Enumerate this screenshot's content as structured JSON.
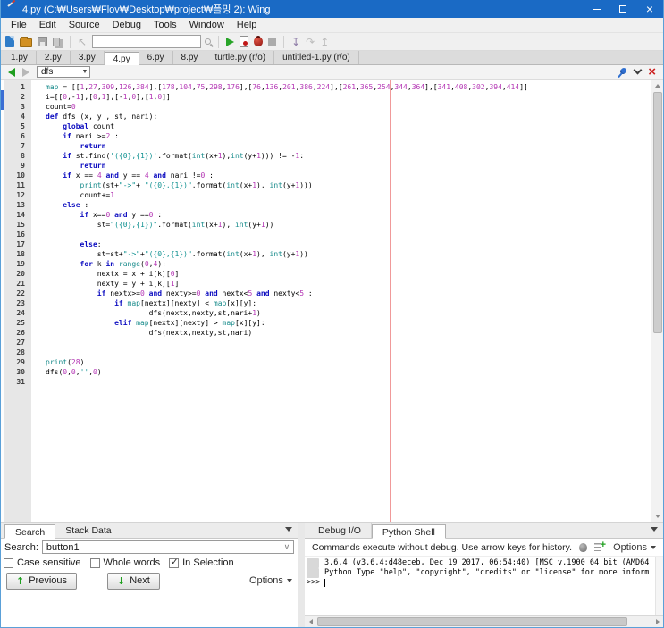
{
  "window": {
    "title": "4.py (C:₩Users₩Flov₩Desktop₩project₩플밍 2): Wing"
  },
  "menu": {
    "items": [
      "File",
      "Edit",
      "Source",
      "Debug",
      "Tools",
      "Window",
      "Help"
    ]
  },
  "toolbar": {
    "search_value": ""
  },
  "file_tabs": {
    "tabs": [
      {
        "label": "1.py",
        "active": false
      },
      {
        "label": "2.py",
        "active": false
      },
      {
        "label": "3.py",
        "active": false
      },
      {
        "label": "4.py",
        "active": true
      },
      {
        "label": "6.py",
        "active": false
      },
      {
        "label": "8.py",
        "active": false
      },
      {
        "label": "turtle.py (r/o)",
        "active": false
      },
      {
        "label": "untitled-1.py (r/o)",
        "active": false
      }
    ]
  },
  "nav": {
    "symbol_selector": "dfs"
  },
  "editor": {
    "syntax_colors": {
      "keyword": "#0d0dc0",
      "builtin": "#188b8b",
      "string": "#0f9191",
      "number": "#b435b4",
      "edge_line": "#f09999"
    },
    "code_lines": [
      "map = [[1,27,309,126,384],[178,104,75,298,176],[76,136,201,386,224],[261,365,254,344,364],[341,408,302,394,414]]",
      "i=[[0,-1],[0,1],[-1,0],[1,0]]",
      "count=0",
      "def dfs (x, y , st, nari):",
      "    global count",
      "    if nari >=2 :",
      "        return",
      "    if st.find('({0},{1})'.format(int(x+1),int(y+1))) != -1:",
      "        return",
      "    if x == 4 and y == 4 and nari !=0 :",
      "        print(st+\"->\"+ \"({0},{1})\".format(int(x+1), int(y+1)))",
      "        count+=1",
      "    else :",
      "        if x==0 and y ==0 :",
      "            st=\"({0},{1})\".format(int(x+1), int(y+1))",
      "",
      "        else:",
      "            st=st+\"->\"+\"({0},{1})\".format(int(x+1), int(y+1))",
      "        for k in range(0,4):",
      "            nextx = x + i[k][0]",
      "            nexty = y + i[k][1]",
      "            if nextx>=0 and nexty>=0 and nextx<5 and nexty<5 :",
      "                if map[nextx][nexty] < map[x][y]:",
      "                        dfs(nextx,nexty,st,nari+1)",
      "                elif map[nextx][nexty] > map[x][y]:",
      "                        dfs(nextx,nexty,st,nari)",
      "",
      "",
      "print(28)",
      "dfs(0,0,'',0)",
      ""
    ]
  },
  "search_panel": {
    "tabs": [
      {
        "label": "Search",
        "active": true
      },
      {
        "label": "Stack Data",
        "active": false
      }
    ],
    "search_label": "Search:",
    "search_value": "button1",
    "checkboxes": [
      {
        "label": "Case sensitive",
        "checked": false
      },
      {
        "label": "Whole words",
        "checked": false
      },
      {
        "label": "In Selection",
        "checked": true
      }
    ],
    "previous_button": "Previous",
    "next_button": "Next",
    "options_label": "Options"
  },
  "shell_panel": {
    "tabs": [
      {
        "label": "Debug I/O",
        "active": false
      },
      {
        "label": "Python Shell",
        "active": true
      }
    ],
    "info_text": "Commands execute without debug.  Use arrow keys for history.",
    "options_label": "Options",
    "output_lines": [
      "3.6.4 (v3.6.4:d48eceb, Dec 19 2017, 06:54:40) [MSC v.1900 64 bit (AMD64",
      "Python Type \"help\", \"copyright\", \"credits\" or \"license\" for more inform"
    ],
    "prompt": ">>>"
  }
}
